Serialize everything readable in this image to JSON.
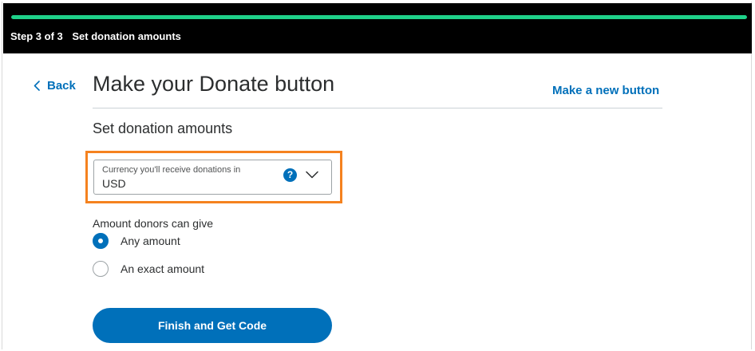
{
  "progress": {
    "fraction": 1.0,
    "step_label": "Step 3 of 3",
    "step_title": "Set donation amounts",
    "color": "#1ed189"
  },
  "nav": {
    "back_label": "Back",
    "back_icon": "chevron-left-icon"
  },
  "header": {
    "title": "Make your Donate button",
    "new_button_label": "Make a new button"
  },
  "section": {
    "title": "Set donation amounts"
  },
  "currency": {
    "label": "Currency you'll receive donations in",
    "value": "USD",
    "help_icon": "?",
    "dropdown_icon": "chevron-down-icon"
  },
  "amount": {
    "group_label": "Amount donors can give",
    "options": [
      {
        "label": "Any amount",
        "selected": true
      },
      {
        "label": "An exact amount",
        "selected": false
      }
    ]
  },
  "actions": {
    "finish_label": "Finish and Get Code"
  },
  "colors": {
    "accent": "#0070ba",
    "highlight": "#f5821f",
    "topbar": "#000000"
  }
}
